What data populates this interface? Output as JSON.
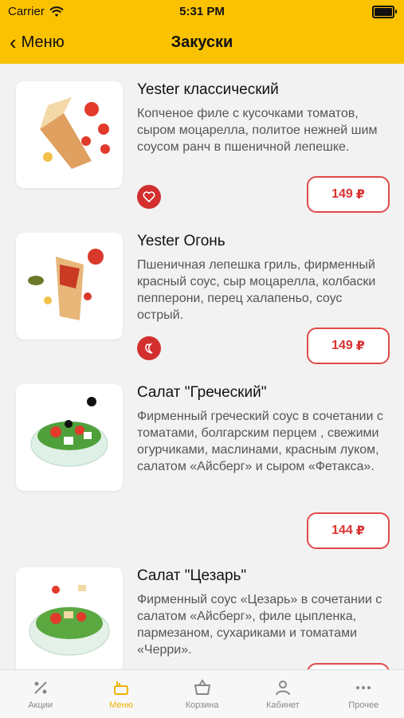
{
  "status": {
    "carrier": "Carrier",
    "time": "5:31 PM"
  },
  "header": {
    "back_label": "Меню",
    "title": "Закуски"
  },
  "items": [
    {
      "name": "Yester классический",
      "description": "Копченое филе с кусочками томатов, сыром моцарелла, политое нежней шим соусом ранч в пшеничной лепешке.",
      "price": "149",
      "currency": "₽",
      "badge": "heart-icon"
    },
    {
      "name": "Yester Огонь",
      "description": "Пшеничная лепешка гриль, фирменный красный соус, сыр моцарелла, колбаски пепперони, перец халапеньо, соус острый.",
      "price": "149",
      "currency": "₽",
      "badge": "chili-pepper-icon"
    },
    {
      "name": "Салат \"Греческий\"",
      "description": "Фирменный греческий соус в сочетании с томатами, болгарским перцем , свежими огурчиками, маслинами, красным луком, салатом «Айсберг» и сыром «Фетакса».",
      "price": "144",
      "currency": "₽",
      "badge": ""
    },
    {
      "name": "Салат \"Цезарь\"",
      "description": "Фирменный соус «Цезарь» в сочетании с салатом «Айсберг», филе цыпленка, пармезаном, сухариками и томатами «Черри».",
      "price": "",
      "currency": "",
      "badge": ""
    }
  ],
  "tabs": [
    {
      "label": "Акции",
      "icon": "percent-icon"
    },
    {
      "label": "Меню",
      "icon": "menu-icon",
      "active": true
    },
    {
      "label": "Корзина",
      "icon": "basket-icon"
    },
    {
      "label": "Кабинет",
      "icon": "user-icon"
    },
    {
      "label": "Прочее",
      "icon": "more-icon"
    }
  ],
  "colors": {
    "accent": "#fbc202",
    "price_red": "#d93434",
    "tab_active": "#f2b100"
  }
}
